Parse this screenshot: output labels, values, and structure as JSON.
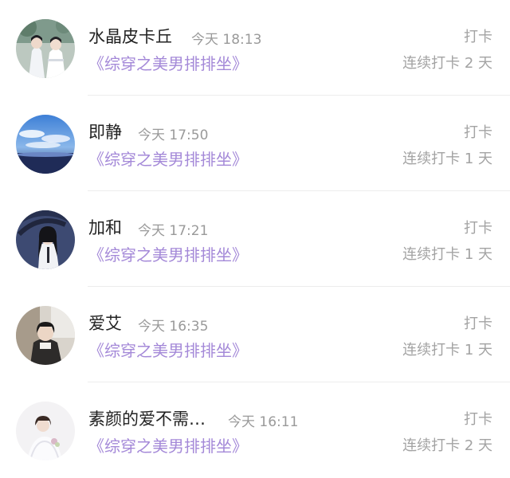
{
  "entries": [
    {
      "name": "水晶皮卡丘",
      "time": "今天 18:13",
      "book": "《综穿之美男排排坐》",
      "checkin_label": "打卡",
      "streak": "连续打卡 2 天",
      "avatar_icon": "two-figures-avatar-icon"
    },
    {
      "name": "即静",
      "time": "今天 17:50",
      "book": "《综穿之美男排排坐》",
      "checkin_label": "打卡",
      "streak": "连续打卡 1 天",
      "avatar_icon": "sky-clouds-avatar-icon"
    },
    {
      "name": "加和",
      "time": "今天 17:21",
      "book": "《综穿之美男排排坐》",
      "checkin_label": "打卡",
      "streak": "连续打卡 1 天",
      "avatar_icon": "girl-umbrella-avatar-icon"
    },
    {
      "name": "爱艾",
      "time": "今天 16:35",
      "book": "《综穿之美男排排坐》",
      "checkin_label": "打卡",
      "streak": "连续打卡 1 天",
      "avatar_icon": "boy-portrait-avatar-icon"
    },
    {
      "name": "素颜的爱不需…",
      "time": "今天 16:11",
      "book": "《综穿之美男排排坐》",
      "checkin_label": "打卡",
      "streak": "连续打卡 2 天",
      "avatar_icon": "bride-avatar-icon"
    }
  ],
  "colors": {
    "book_link": "#a489d8",
    "name_text": "#222222",
    "muted_text": "#9a9a9a"
  }
}
